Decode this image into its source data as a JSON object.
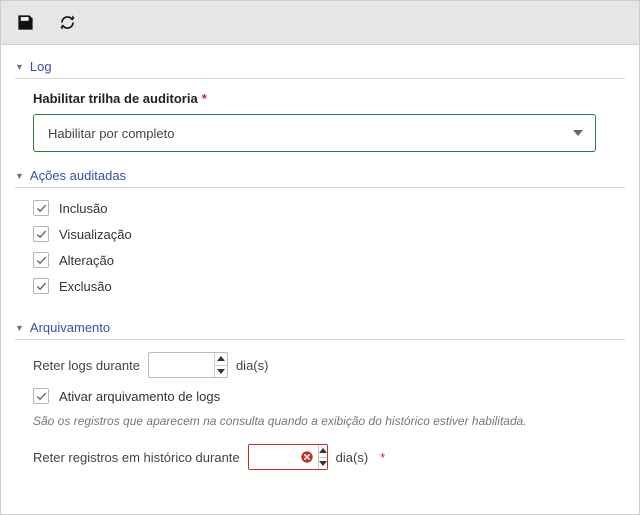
{
  "sections": {
    "log": {
      "title": "Log",
      "field_label": "Habilitar trilha de auditoria",
      "select_value": "Habilitar por completo"
    },
    "acoes": {
      "title": "Ações auditadas",
      "items": [
        "Inclusão",
        "Visualização",
        "Alteração",
        "Exclusão"
      ]
    },
    "arquivamento": {
      "title": "Arquivamento",
      "retain_logs_label_pre": "Reter logs durante",
      "retain_logs_value": "",
      "retain_logs_unit": "dia(s)",
      "enable_archive_label": "Ativar arquivamento de logs",
      "hint": "São os registros que aparecem na consulta quando a exibição do histórico estiver habilitada.",
      "retain_history_label_pre": "Reter registros em histórico durante",
      "retain_history_value": "",
      "retain_history_unit": "dia(s)"
    }
  }
}
